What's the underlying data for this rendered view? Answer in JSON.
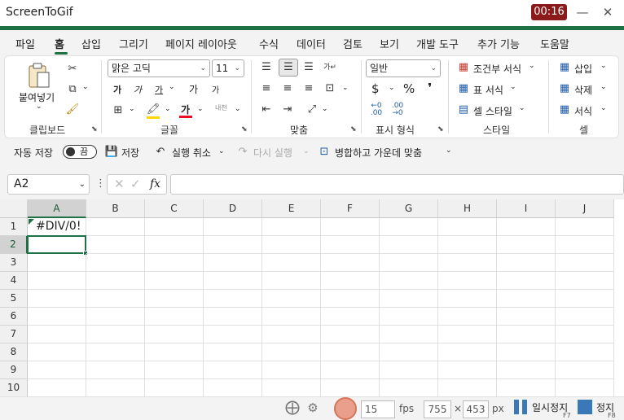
{
  "window": {
    "title": "ScreenToGif",
    "timer": "00:16",
    "minimize_glyph": "—",
    "close_glyph": "✕"
  },
  "tabs": [
    "파일",
    "홈",
    "삽입",
    "그리기",
    "페이지 레이아웃",
    "수식",
    "데이터",
    "검토",
    "보기",
    "개발 도구",
    "추가 기능",
    "도움말"
  ],
  "ribbon": {
    "clipboard": {
      "paste_label": "붙여넣기",
      "group_label": "클립보드"
    },
    "font": {
      "font_name": "맑은 고딕",
      "font_size": "11",
      "group_label": "글꼴",
      "bold": "가",
      "italic": "가",
      "underline": "가",
      "grow": "가",
      "shrink": "가",
      "font_color": "가",
      "phonetic": "내천"
    },
    "alignment": {
      "group_label": "맞춤"
    },
    "number": {
      "format": "일반",
      "currency": "$",
      "percent": "%",
      "comma": "❜",
      "group_label": "표시 형식"
    },
    "styles": {
      "conditional": "조건부 서식",
      "table": "표 서식",
      "cell_style": "셀 스타일",
      "group_label": "스타일"
    },
    "cells": {
      "insert": "삽입",
      "delete": "삭제",
      "format": "서식",
      "group_label": "셀"
    },
    "colors": {
      "accent": "#1e7145",
      "font_red": "#e81123",
      "highlight": "#ffd700"
    }
  },
  "qat": {
    "autosave": "자동 저장",
    "autosave_state": "끔",
    "save": "저장",
    "undo": "실행 취소",
    "redo": "다시 실행",
    "merge": "병합하고 가운데 맞춤"
  },
  "formula_bar": {
    "name_box": "A2",
    "fx": "fx",
    "content": ""
  },
  "grid": {
    "columns": [
      "A",
      "B",
      "C",
      "D",
      "E",
      "F",
      "G",
      "H",
      "I",
      "J"
    ],
    "rows": [
      "1",
      "2",
      "3",
      "4",
      "5",
      "6",
      "7",
      "8",
      "9",
      "10"
    ],
    "cells": {
      "A1": "#DIV/0!"
    },
    "selected": "A2"
  },
  "status": {
    "fps_value": "15",
    "fps_unit": "fps",
    "width": "755",
    "times": "×",
    "height": "453",
    "px_unit": "px",
    "pause": "일시정지",
    "pause_key": "F7",
    "stop": "정지",
    "stop_key": "F8"
  }
}
